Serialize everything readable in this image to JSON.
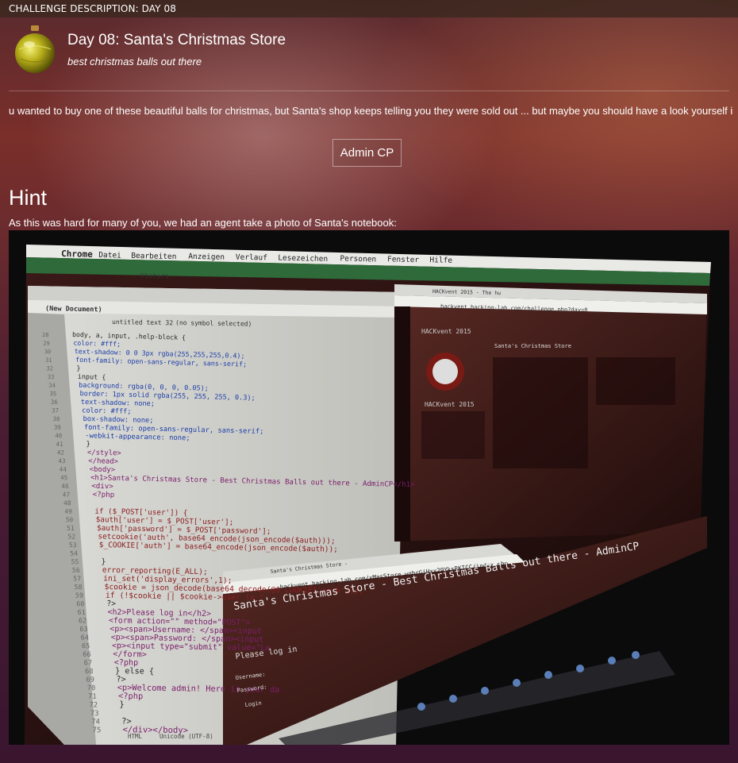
{
  "topbar": {
    "label": "CHALLENGE DESCRIPTION: DAY 08"
  },
  "challenge": {
    "title": "Day 08: Santa's Christmas Store",
    "subtitle": "best christmas balls out there",
    "description": "u wanted to buy one of these beautiful balls for christmas, but Santa's shop keeps telling you they were sold out ... but maybe you should have a look yourself in the ...",
    "admin_button": "Admin CP"
  },
  "hint": {
    "heading": "Hint",
    "text": "As this was hard for many of you, we had an agent take a photo of Santa's notebook:"
  },
  "photo": {
    "menubar": [
      "Chrome",
      "Datei",
      "Bearbeiten",
      "Anzeigen",
      "Verlauf",
      "Lesezeichen",
      "Personen",
      "Fenster",
      "Hilfe"
    ],
    "tab_label": "Vistars",
    "editor_doc": "(New Document)",
    "editor_file": "untitled text 32",
    "editor_symbol": "(no symbol selected)",
    "code_lines": [
      "body, a, input, .help-block {",
      "    color: #fff;",
      "    text-shadow: 0 0 3px rgba(255,255,255,0.4);",
      "    font-family: open-sans-regular, sans-serif;",
      "}",
      "input {",
      "    background: rgba(0, 0, 0, 0.05);",
      "    border: 1px solid rgba(255, 255, 255, 0.3);",
      "    text-shadow: none;",
      "    color: #fff;",
      "    box-shadow: none;",
      "    font-family: open-sans-regular, sans-serif;",
      "    -webkit-appearance: none;",
      "}",
      "</style>",
      "</head>",
      "<body>",
      "<h1>Santa's Christmas Store - Best Christmas Balls out there - AdminCP</h1>",
      "<div>",
      "<?php",
      "",
      "if ($_POST['user']) {",
      "    $auth['user'] = $_POST['user'];",
      "    $auth['password'] = $_POST['password'];",
      "    setcookie('auth', base64_encode(json_encode($auth)));",
      "    $_COOKIE['auth'] = base64_encode(json_encode($auth));",
      "",
      "}",
      "error_reporting(E_ALL);",
      "ini_set('display_errors',1);",
      "$cookie = json_decode(base64_decode(@$_COOKIE['auth']));",
      "if (!$cookie || $cookie->user != \"",
      "?>",
      "<h2>Please log in</h2>",
      "<form action=\"\" method=\"POST\">",
      "<p><span>Username: </span><input",
      "<p><span>Password: </span><input",
      "<p><input type=\"submit\" value=\"Lo",
      "</form>",
      "<?php",
      "} else {",
      "?>",
      "<p>Welcome admin! Here is your da",
      "<?php",
      "}",
      "",
      "?>",
      "</div></body>"
    ],
    "line_start": 28,
    "back_browser_title": "HACKvent 2015 - The hu",
    "back_browser_url": "hackvent.hacking-lab.com/challenge.php?day=8",
    "back_app_title": "HACKvent 2015",
    "back_page_title": "Santa's Christmas Store",
    "front_tab": "Santa's Christmas Store -",
    "front_url": "hackvent.hacking-lab.com/xMasStore_wqbrGjHxx29YksRKICC/index.php",
    "front_heading": "Santa's Christmas Store - Best Christmas Balls out there - AdminCP",
    "front_login": "Please log in",
    "front_user": "Username:",
    "front_pass": "Password:",
    "front_btn": "Login",
    "status_encoding": "Unicode (UTF-8)",
    "status_lang": "HTML"
  },
  "colors": {
    "accent": "#8b2b2e",
    "ornament": "#c9c21a"
  }
}
